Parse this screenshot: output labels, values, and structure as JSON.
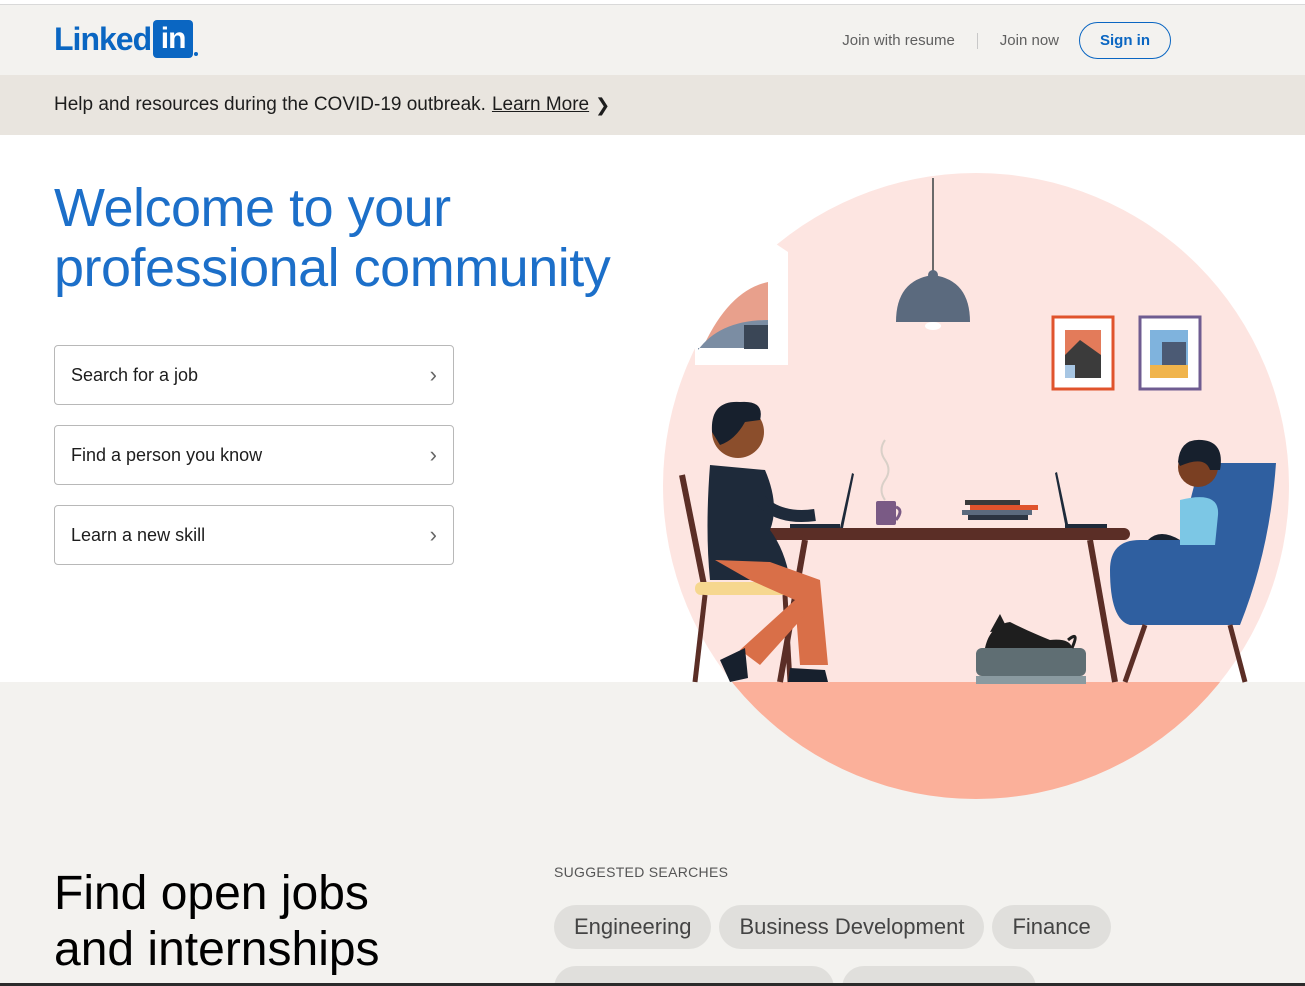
{
  "header": {
    "logo_text": "Linked",
    "logo_box": "in",
    "join_resume": "Join with resume",
    "join_now": "Join now",
    "sign_in": "Sign in"
  },
  "banner": {
    "text": "Help and resources during the COVID-19 outbreak.",
    "link": "Learn More",
    "chevron": "❯"
  },
  "hero": {
    "title": "Welcome to your professional community",
    "options": [
      {
        "label": "Search for a job",
        "chevron": "›"
      },
      {
        "label": "Find a person you know",
        "chevron": "›"
      },
      {
        "label": "Learn a new skill",
        "chevron": "›"
      }
    ]
  },
  "jobs": {
    "title_line1": "Find open jobs",
    "title_line2": "and internships",
    "suggested_label": "SUGGESTED SEARCHES",
    "pills": [
      "Engineering",
      "Business Development",
      "Finance"
    ]
  },
  "colors": {
    "brand": "#0a66c2",
    "hero_title": "#1c6fc9",
    "circle_bg": "#fde5e1",
    "floor": "#fbb09a"
  }
}
